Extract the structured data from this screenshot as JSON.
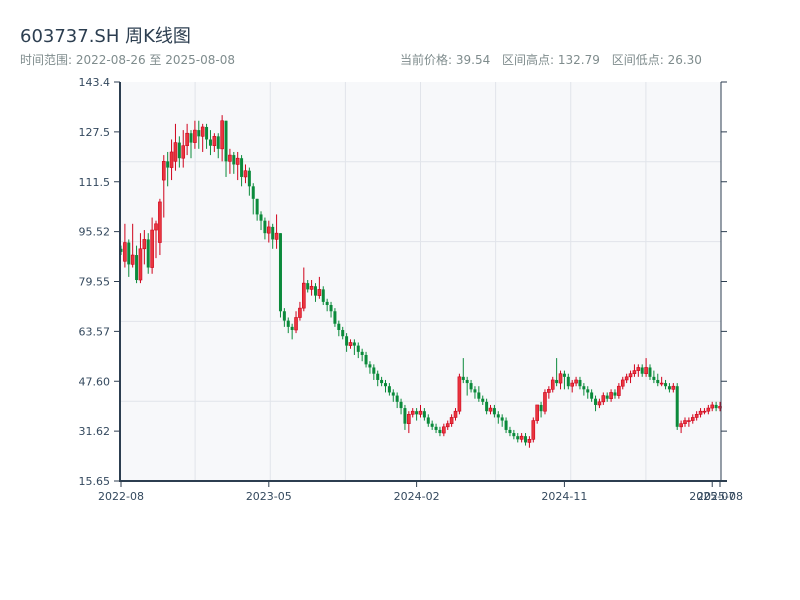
{
  "header": {
    "title": "603737.SH 周K线图",
    "range_label": "时间范围: 2022-08-26 至 2025-08-08",
    "current_price": "当前价格: 39.54",
    "high": "区间高点: 132.79",
    "low": "区间低点: 26.30"
  },
  "colors": {
    "up": "#d0021b",
    "up_fill": "#e8363f",
    "down": "#0b8a3b",
    "axis": "#2c3e50",
    "grid": "#e1e4ea",
    "plot_bg": "#f7f8fa"
  },
  "chart_data": {
    "type": "candlestick",
    "title": "603737.SH 周K线图",
    "up_color_meaning": "red = up, green = down",
    "ylim": [
      15.65,
      143.4
    ],
    "y_ticks": [
      "15.65",
      "31.62",
      "47.60",
      "63.57",
      "79.55",
      "95.52",
      "111.5",
      "127.5",
      "143.4"
    ],
    "x_ticks": [
      {
        "label": "2022-08",
        "index": 0
      },
      {
        "label": "2023-05",
        "index": 38
      },
      {
        "label": "2024-02",
        "index": 76
      },
      {
        "label": "2024-11",
        "index": 114
      },
      {
        "label": "2025-07",
        "index": 152
      },
      {
        "label": "2025-08",
        "index": 154
      }
    ],
    "grid": true,
    "start_date": "2022-08-26",
    "end_date": "2025-08-08",
    "ohlc": [
      [
        90,
        91,
        88,
        89
      ],
      [
        86,
        98,
        84,
        92
      ],
      [
        92,
        93,
        81,
        85
      ],
      [
        85,
        98,
        84,
        88
      ],
      [
        88,
        91,
        79,
        80
      ],
      [
        80,
        95,
        79,
        90
      ],
      [
        90,
        96,
        85,
        93
      ],
      [
        93,
        95,
        82,
        84
      ],
      [
        84,
        100,
        82,
        96
      ],
      [
        96,
        99,
        87,
        98
      ],
      [
        92,
        106,
        88,
        105
      ],
      [
        112,
        120,
        100,
        118
      ],
      [
        118,
        121,
        110,
        116
      ],
      [
        116,
        125,
        112,
        121
      ],
      [
        118,
        130,
        115,
        124
      ],
      [
        124,
        126,
        116,
        119
      ],
      [
        119,
        128,
        116,
        123
      ],
      [
        123,
        130,
        120,
        127
      ],
      [
        127,
        128,
        119,
        124
      ],
      [
        124,
        131,
        122,
        128
      ],
      [
        128,
        131,
        122,
        126
      ],
      [
        126,
        130,
        121,
        129
      ],
      [
        129,
        130,
        122,
        125
      ],
      [
        125,
        128,
        120,
        123
      ],
      [
        123,
        127,
        121,
        126
      ],
      [
        126,
        127,
        119,
        122
      ],
      [
        122,
        132.79,
        118,
        131
      ],
      [
        131,
        131,
        113,
        118
      ],
      [
        118,
        122,
        114,
        120
      ],
      [
        120,
        121,
        114,
        117
      ],
      [
        117,
        121,
        112,
        119
      ],
      [
        119,
        120,
        110,
        113
      ],
      [
        113,
        117,
        111,
        115
      ],
      [
        115,
        116,
        107,
        110
      ],
      [
        110,
        111,
        101,
        106
      ],
      [
        106,
        106,
        99,
        101
      ],
      [
        101,
        102,
        96,
        99
      ],
      [
        99,
        100,
        93,
        95
      ],
      [
        95,
        99,
        92,
        97
      ],
      [
        97,
        98,
        90,
        93
      ],
      [
        93,
        101,
        90,
        95
      ],
      [
        95,
        95,
        68,
        70
      ],
      [
        70,
        71,
        65,
        67
      ],
      [
        67,
        68,
        63,
        65
      ],
      [
        65,
        66,
        61,
        64
      ],
      [
        64,
        70,
        63,
        68
      ],
      [
        68,
        73,
        67,
        71
      ],
      [
        71,
        84,
        70,
        79
      ],
      [
        79,
        80,
        76,
        77
      ],
      [
        77,
        80,
        75,
        78
      ],
      [
        78,
        79,
        73,
        75
      ],
      [
        75,
        81,
        74,
        77
      ],
      [
        77,
        78,
        72,
        73
      ],
      [
        73,
        74,
        70,
        72
      ],
      [
        72,
        73,
        68,
        70
      ],
      [
        70,
        71,
        65,
        66
      ],
      [
        66,
        67,
        62,
        64
      ],
      [
        64,
        65,
        61,
        62
      ],
      [
        62,
        63,
        57,
        59
      ],
      [
        59,
        61,
        58,
        60
      ],
      [
        60,
        61,
        56,
        59
      ],
      [
        59,
        60,
        55,
        57
      ],
      [
        57,
        58,
        54,
        56
      ],
      [
        56,
        57,
        52,
        53
      ],
      [
        53,
        54,
        50,
        52
      ],
      [
        52,
        53,
        48,
        50
      ],
      [
        50,
        51,
        46,
        48
      ],
      [
        48,
        49,
        46,
        47
      ],
      [
        47,
        48,
        44,
        46
      ],
      [
        46,
        47,
        43,
        44
      ],
      [
        44,
        45,
        41,
        43
      ],
      [
        43,
        44,
        39,
        41
      ],
      [
        41,
        42,
        37,
        39
      ],
      [
        39,
        40,
        32,
        34
      ],
      [
        34,
        38,
        31,
        37
      ],
      [
        37,
        39,
        36,
        38
      ],
      [
        38,
        39,
        35,
        37
      ],
      [
        37,
        40,
        36,
        38
      ],
      [
        38,
        39,
        35,
        36
      ],
      [
        36,
        37,
        33,
        34
      ],
      [
        34,
        35,
        32,
        33
      ],
      [
        33,
        34,
        31,
        32
      ],
      [
        32,
        33,
        30,
        31
      ],
      [
        31,
        34,
        30,
        33
      ],
      [
        33,
        35,
        32,
        34
      ],
      [
        34,
        37,
        33,
        36
      ],
      [
        36,
        39,
        35,
        38
      ],
      [
        38,
        50,
        37,
        49
      ],
      [
        49,
        55,
        47,
        48
      ],
      [
        48,
        49,
        43,
        47
      ],
      [
        47,
        48,
        44,
        45
      ],
      [
        45,
        46,
        42,
        44
      ],
      [
        44,
        46,
        41,
        42
      ],
      [
        42,
        43,
        40,
        41
      ],
      [
        41,
        42,
        37,
        38
      ],
      [
        38,
        40,
        37,
        39
      ],
      [
        39,
        40,
        36,
        37
      ],
      [
        37,
        38,
        34,
        36
      ],
      [
        36,
        37,
        33,
        35
      ],
      [
        35,
        36,
        31,
        32
      ],
      [
        32,
        33,
        30,
        31
      ],
      [
        31,
        32,
        29,
        30
      ],
      [
        30,
        31,
        28,
        29
      ],
      [
        29,
        31,
        28,
        30
      ],
      [
        30,
        31,
        27,
        28
      ],
      [
        28,
        30,
        26.3,
        29
      ],
      [
        29,
        36,
        28,
        35
      ],
      [
        35,
        40,
        34,
        40
      ],
      [
        40,
        41,
        36,
        38
      ],
      [
        38,
        45,
        37,
        44
      ],
      [
        44,
        46,
        42,
        45
      ],
      [
        45,
        49,
        44,
        48
      ],
      [
        48,
        55,
        46,
        47
      ],
      [
        47,
        51,
        45,
        50
      ],
      [
        50,
        51,
        45,
        49
      ],
      [
        49,
        50,
        45,
        46
      ],
      [
        46,
        48,
        44,
        47
      ],
      [
        47,
        49,
        46,
        48
      ],
      [
        48,
        49,
        45,
        46
      ],
      [
        46,
        47,
        43,
        45
      ],
      [
        45,
        46,
        42,
        44
      ],
      [
        44,
        45,
        41,
        42
      ],
      [
        42,
        43,
        38,
        40
      ],
      [
        40,
        42,
        39,
        41
      ],
      [
        41,
        44,
        40,
        43
      ],
      [
        43,
        44,
        41,
        42
      ],
      [
        42,
        45,
        41,
        44
      ],
      [
        44,
        45,
        42,
        43
      ],
      [
        43,
        47,
        42,
        46
      ],
      [
        46,
        49,
        45,
        48
      ],
      [
        48,
        50,
        47,
        49
      ],
      [
        49,
        51,
        47,
        50
      ],
      [
        50,
        53,
        49,
        51
      ],
      [
        51,
        53,
        49,
        52
      ],
      [
        52,
        53,
        49,
        50
      ],
      [
        50,
        55,
        49,
        52
      ],
      [
        52,
        53,
        48,
        49
      ],
      [
        49,
        51,
        47,
        48
      ],
      [
        48,
        50,
        46,
        47
      ],
      [
        47,
        49,
        46,
        47
      ],
      [
        47,
        48,
        45,
        46
      ],
      [
        46,
        47,
        44,
        45
      ],
      [
        45,
        47,
        44,
        46
      ],
      [
        46,
        47,
        32,
        33
      ],
      [
        33,
        35,
        31,
        34
      ],
      [
        34,
        36,
        33,
        35
      ],
      [
        35,
        36,
        33,
        35
      ],
      [
        35,
        37,
        34,
        36
      ],
      [
        36,
        38,
        35,
        37
      ],
      [
        37,
        39,
        36,
        38
      ],
      [
        38,
        39,
        37,
        38
      ],
      [
        38,
        40,
        37,
        39
      ],
      [
        39,
        41,
        38,
        40
      ],
      [
        40,
        41,
        38,
        39
      ],
      [
        39,
        41,
        38,
        39.54
      ]
    ]
  }
}
